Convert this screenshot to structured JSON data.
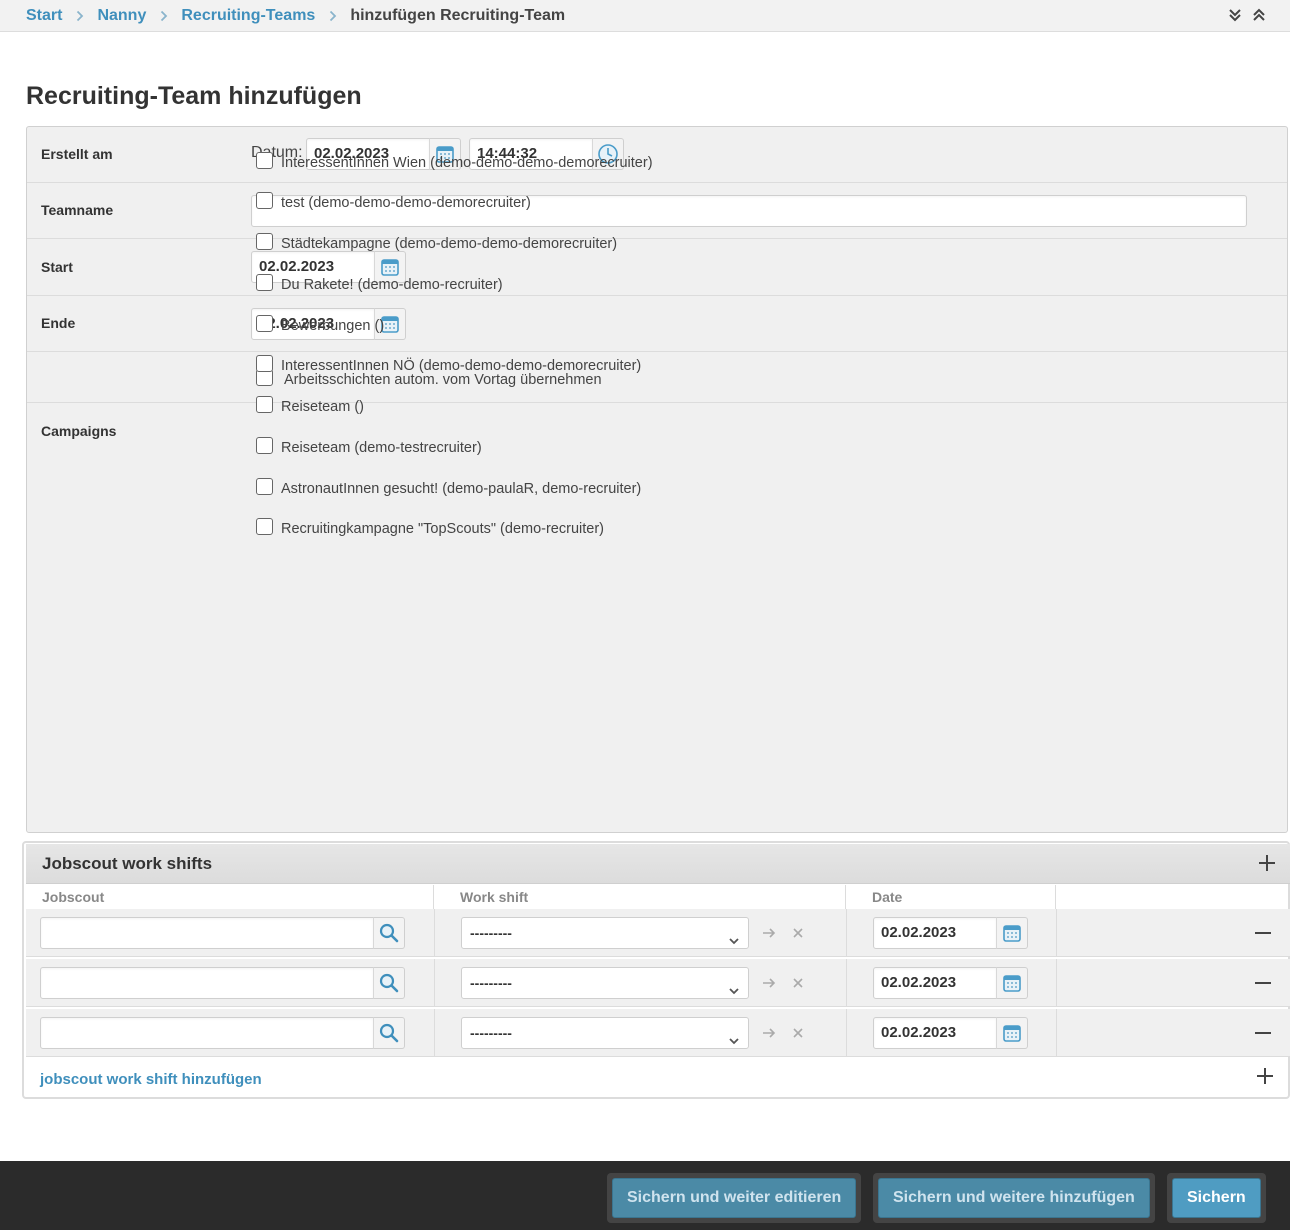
{
  "breadcrumb": {
    "items": [
      "Start",
      "Nanny",
      "Recruiting-Teams"
    ],
    "current": "hinzufügen Recruiting-Team"
  },
  "page_title": "Recruiting-Team hinzufügen",
  "form": {
    "created": {
      "label": "Erstellt am",
      "datum_label": "Datum:",
      "date": "02.02.2023",
      "time": "14:44:32"
    },
    "teamname": {
      "label": "Teamname",
      "value": ""
    },
    "start": {
      "label": "Start",
      "value": "02.02.2023"
    },
    "ende": {
      "label": "Ende",
      "value": "02.02.2023"
    },
    "auto_shift": {
      "label": "Arbeitsschichten autom. vom Vortag übernehmen",
      "checked": false
    },
    "campaigns": {
      "label": "Campaigns",
      "options": [
        "InteressentInnen Wien (demo-demo-demo-demorecruiter)",
        "test (demo-demo-demo-demorecruiter)",
        "Städtekampagne (demo-demo-demo-demorecruiter)",
        "Du Rakete! (demo-demo-recruiter)",
        "Bewerbungen ()",
        "InteressentInnen NÖ (demo-demo-demo-demorecruiter)",
        "Reiseteam ()",
        "Reiseteam (demo-testrecruiter)",
        "AstronautInnen gesucht! (demo-paulaR, demo-recruiter)",
        "Recruitingkampagne \"TopScouts\" (demo-recruiter)"
      ]
    }
  },
  "inline": {
    "title": "Jobscout work shifts",
    "columns": [
      "Jobscout",
      "Work shift",
      "Date"
    ],
    "rows": [
      {
        "jobscout": "",
        "shift": "---------",
        "date": "02.02.2023"
      },
      {
        "jobscout": "",
        "shift": "---------",
        "date": "02.02.2023"
      },
      {
        "jobscout": "",
        "shift": "---------",
        "date": "02.02.2023"
      }
    ],
    "add_label": "jobscout work shift hinzufügen"
  },
  "footer": {
    "save_continue": "Sichern und weiter editieren",
    "save_add": "Sichern und weitere hinzufügen",
    "save": "Sichern"
  },
  "colors": {
    "link": "#3f8fbc",
    "button": "#4b8aa6",
    "footer_bg": "#2b2b2b"
  }
}
